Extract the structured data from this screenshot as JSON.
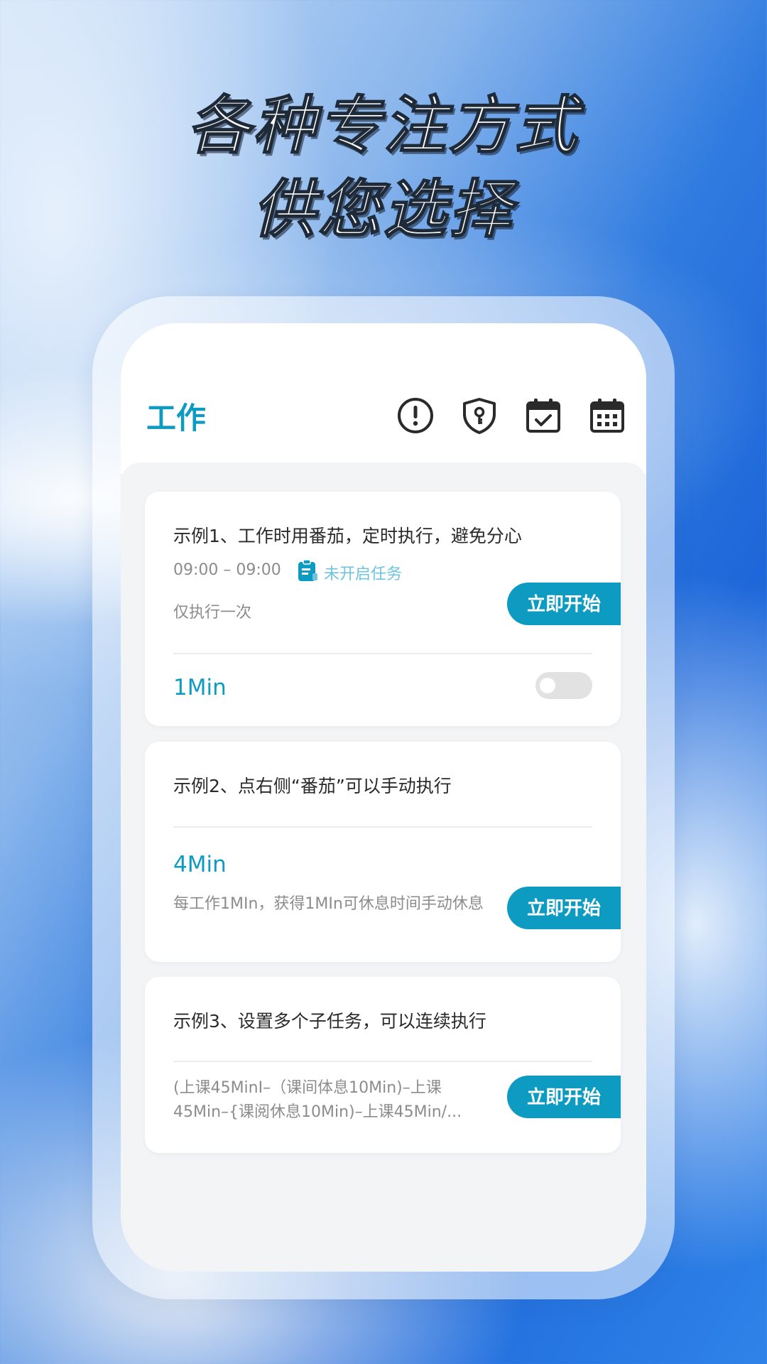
{
  "headline": {
    "line1": "各种专注方式",
    "line2": "供您选择"
  },
  "appbar": {
    "title": "工作",
    "icons": [
      "alert-icon",
      "shield-key-icon",
      "calendar-check-icon",
      "calendar-grid-icon"
    ]
  },
  "colors": {
    "accent": "#0e9bc2",
    "status_text": "#6ec4e0",
    "muted_text": "#8c8c8c"
  },
  "cards": [
    {
      "title": "示例1、工作时用番茄，定时执行，避免分心",
      "time_range": "09:00 – 09:00",
      "status": "未开启任务",
      "repeat": "仅执行一次",
      "duration": "1Min",
      "start_label": "立即开始",
      "toggle_on": false
    },
    {
      "title": "示例2、点右侧“番茄”可以手动执行",
      "duration": "4Min",
      "description": "每工作1MIn，获得1MIn可休息时间手动休息",
      "start_label": "立即开始"
    },
    {
      "title": "示例3、设置多个子任务，可以连续执行",
      "subtasks": "(上课45MinI–（课间体息10Min)–上课45Min–{课阅休息10Min)–上课45Min/...",
      "start_label": "立即开始"
    }
  ]
}
